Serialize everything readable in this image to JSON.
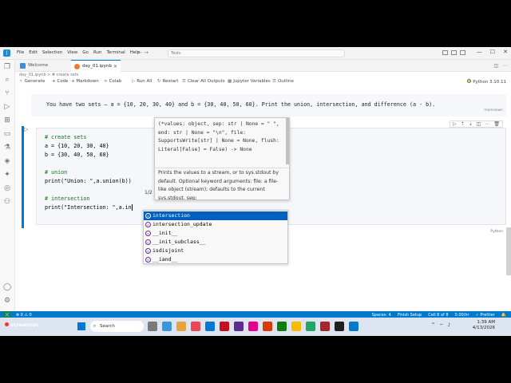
{
  "titlebar": {
    "menu": [
      "File",
      "Edit",
      "Selection",
      "View",
      "Go",
      "Run",
      "Terminal",
      "Help"
    ],
    "search_placeholder": "Tests"
  },
  "tabs": [
    {
      "label": "Welcome"
    },
    {
      "label": "day_01.ipynb"
    }
  ],
  "breadcrumb": "day_01.ipynb > # create sets",
  "toolbar": {
    "generate": "Generate",
    "code": "+ Code",
    "markdown": "+ Markdown",
    "colab": "Colab",
    "run_all": "Run All",
    "restart": "Restart",
    "clear_outputs": "Clear All Outputs",
    "jupyter_variables": "Jupyter Variables",
    "outline": "Outline",
    "kernel": "Python 3.10.11"
  },
  "markdown_cell": {
    "text": "You have two sets — a = {10, 20, 30, 40} and b = {30, 40, 50, 60}. Print the union, intersection, and difference (a - b).",
    "label": "markdown"
  },
  "code_cell": {
    "lines": [
      "# create sets",
      "a = {10, 20, 30, 40}",
      "b = {30, 40, 50, 60}",
      "",
      "# union",
      "print(\"Union: \",a.union(b))",
      "",
      "# intersection",
      "print(\"Intersection: \",a.in"
    ],
    "language": "Python"
  },
  "signature_help": {
    "code": "(*values: object, sep: str | None = \" \", end: str | None = \"\\n\", file: SupportsWrite[str] | None = None, flush: Literal[False] = False) -> None",
    "doc": "Prints the values to a stream, or to sys.stdout by default. Optional keyword arguments: file: a file-like object (stream); defaults to the current sys.stdout. sep:",
    "count": "1/2"
  },
  "suggestions": [
    "intersection",
    "intersection_update",
    "__init__",
    "__init_subclass__",
    "isdisjoint",
    "__iand__"
  ],
  "statusbar": {
    "problems": "⊗ 0 ⚠ 0",
    "spaces": "Spaces: 4",
    "finish_setup": "Finish Setup",
    "cell": "Cell 8 of 8",
    "kernel_status": "0.00/hr",
    "prettier": "✓ Prettier"
  },
  "taskbar": {
    "brand": "screenrec",
    "search": "Search",
    "time": "1:39 AM",
    "date": "4/13/2026"
  },
  "colors": {
    "accent": "#0078d4",
    "statusbar": "#007acc",
    "selection": "#0060c0"
  }
}
